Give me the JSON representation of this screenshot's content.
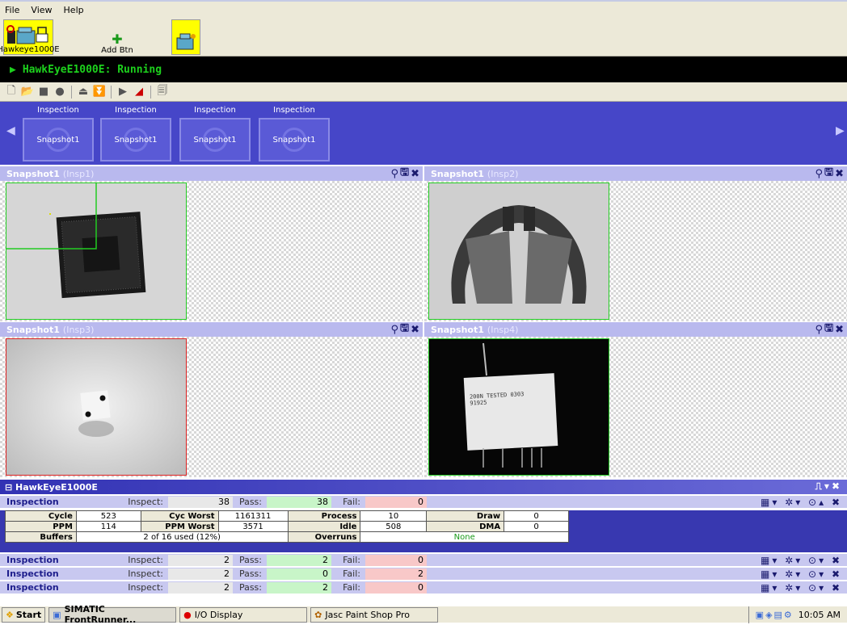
{
  "menu": [
    "File",
    "View",
    "Help"
  ],
  "devices": [
    {
      "label": "Hawkeye1000E",
      "selected": true
    },
    {
      "label": "Add Btn",
      "selected": false
    },
    {
      "label": "",
      "selected": false
    }
  ],
  "status": {
    "text": "HawkEyeE1000E: Running",
    "color": "#1dd11d"
  },
  "inspections_strip": [
    {
      "title": "Inspection",
      "thumb": "Snapshot1"
    },
    {
      "title": "Inspection",
      "thumb": "Snapshot1"
    },
    {
      "title": "Inspection",
      "thumb": "Snapshot1"
    },
    {
      "title": "Inspection",
      "thumb": "Snapshot1"
    }
  ],
  "panes": [
    {
      "name": "Snapshot1",
      "insp": "(Insp1)",
      "border": "#22cc22",
      "image": "bga-chip"
    },
    {
      "name": "Snapshot1",
      "insp": "(Insp2)",
      "border": "#22cc22",
      "image": "clip"
    },
    {
      "name": "Snapshot1",
      "insp": "(Insp3)",
      "border": "#dd2222",
      "image": "die"
    },
    {
      "name": "Snapshot1",
      "insp": "(Insp4)",
      "border": "#22cc22",
      "image": "component"
    }
  ],
  "summary": {
    "device": "⊟ HawkEyeE1000E",
    "rows": [
      {
        "name": "Inspection",
        "inspect_label": "Inspect:",
        "inspect": "38",
        "pass_label": "Pass:",
        "pass": "38",
        "fail_label": "Fail:",
        "fail": "0"
      },
      {
        "name": "Inspection",
        "inspect_label": "Inspect:",
        "inspect": "2",
        "pass_label": "Pass:",
        "pass": "2",
        "fail_label": "Fail:",
        "fail": "0"
      },
      {
        "name": "Inspection",
        "inspect_label": "Inspect:",
        "inspect": "2",
        "pass_label": "Pass:",
        "pass": "0",
        "fail_label": "Fail:",
        "fail": "2"
      },
      {
        "name": "Inspection",
        "inspect_label": "Inspect:",
        "inspect": "2",
        "pass_label": "Pass:",
        "pass": "2",
        "fail_label": "Fail:",
        "fail": "0"
      }
    ],
    "stats": {
      "cycle_k": "Cycle",
      "cycle": "523",
      "cycw_k": "Cyc Worst",
      "cycw": "1161311",
      "process_k": "Process",
      "process": "10",
      "draw_k": "Draw",
      "draw": "0",
      "ppm_k": "PPM",
      "ppm": "114",
      "ppmw_k": "PPM Worst",
      "ppmw": "3571",
      "idle_k": "Idle",
      "idle": "508",
      "dma_k": "DMA",
      "dma": "0",
      "buffers_k": "Buffers",
      "buffers": "2 of 16 used (12%)",
      "overruns_k": "Overruns",
      "overruns": "None"
    }
  },
  "taskbar": {
    "start": "Start",
    "items": [
      "SIMATIC FrontRunner...",
      "I/O Display",
      "Jasc Paint Shop Pro"
    ],
    "clock": "10:05 AM"
  },
  "colors": {
    "accent": "#4646c8",
    "pane_header": "#b9b9ee",
    "pass_box": "#c8f5c8",
    "fail_box": "#f8c8c8",
    "inspect_box": "#e8e8e8"
  }
}
